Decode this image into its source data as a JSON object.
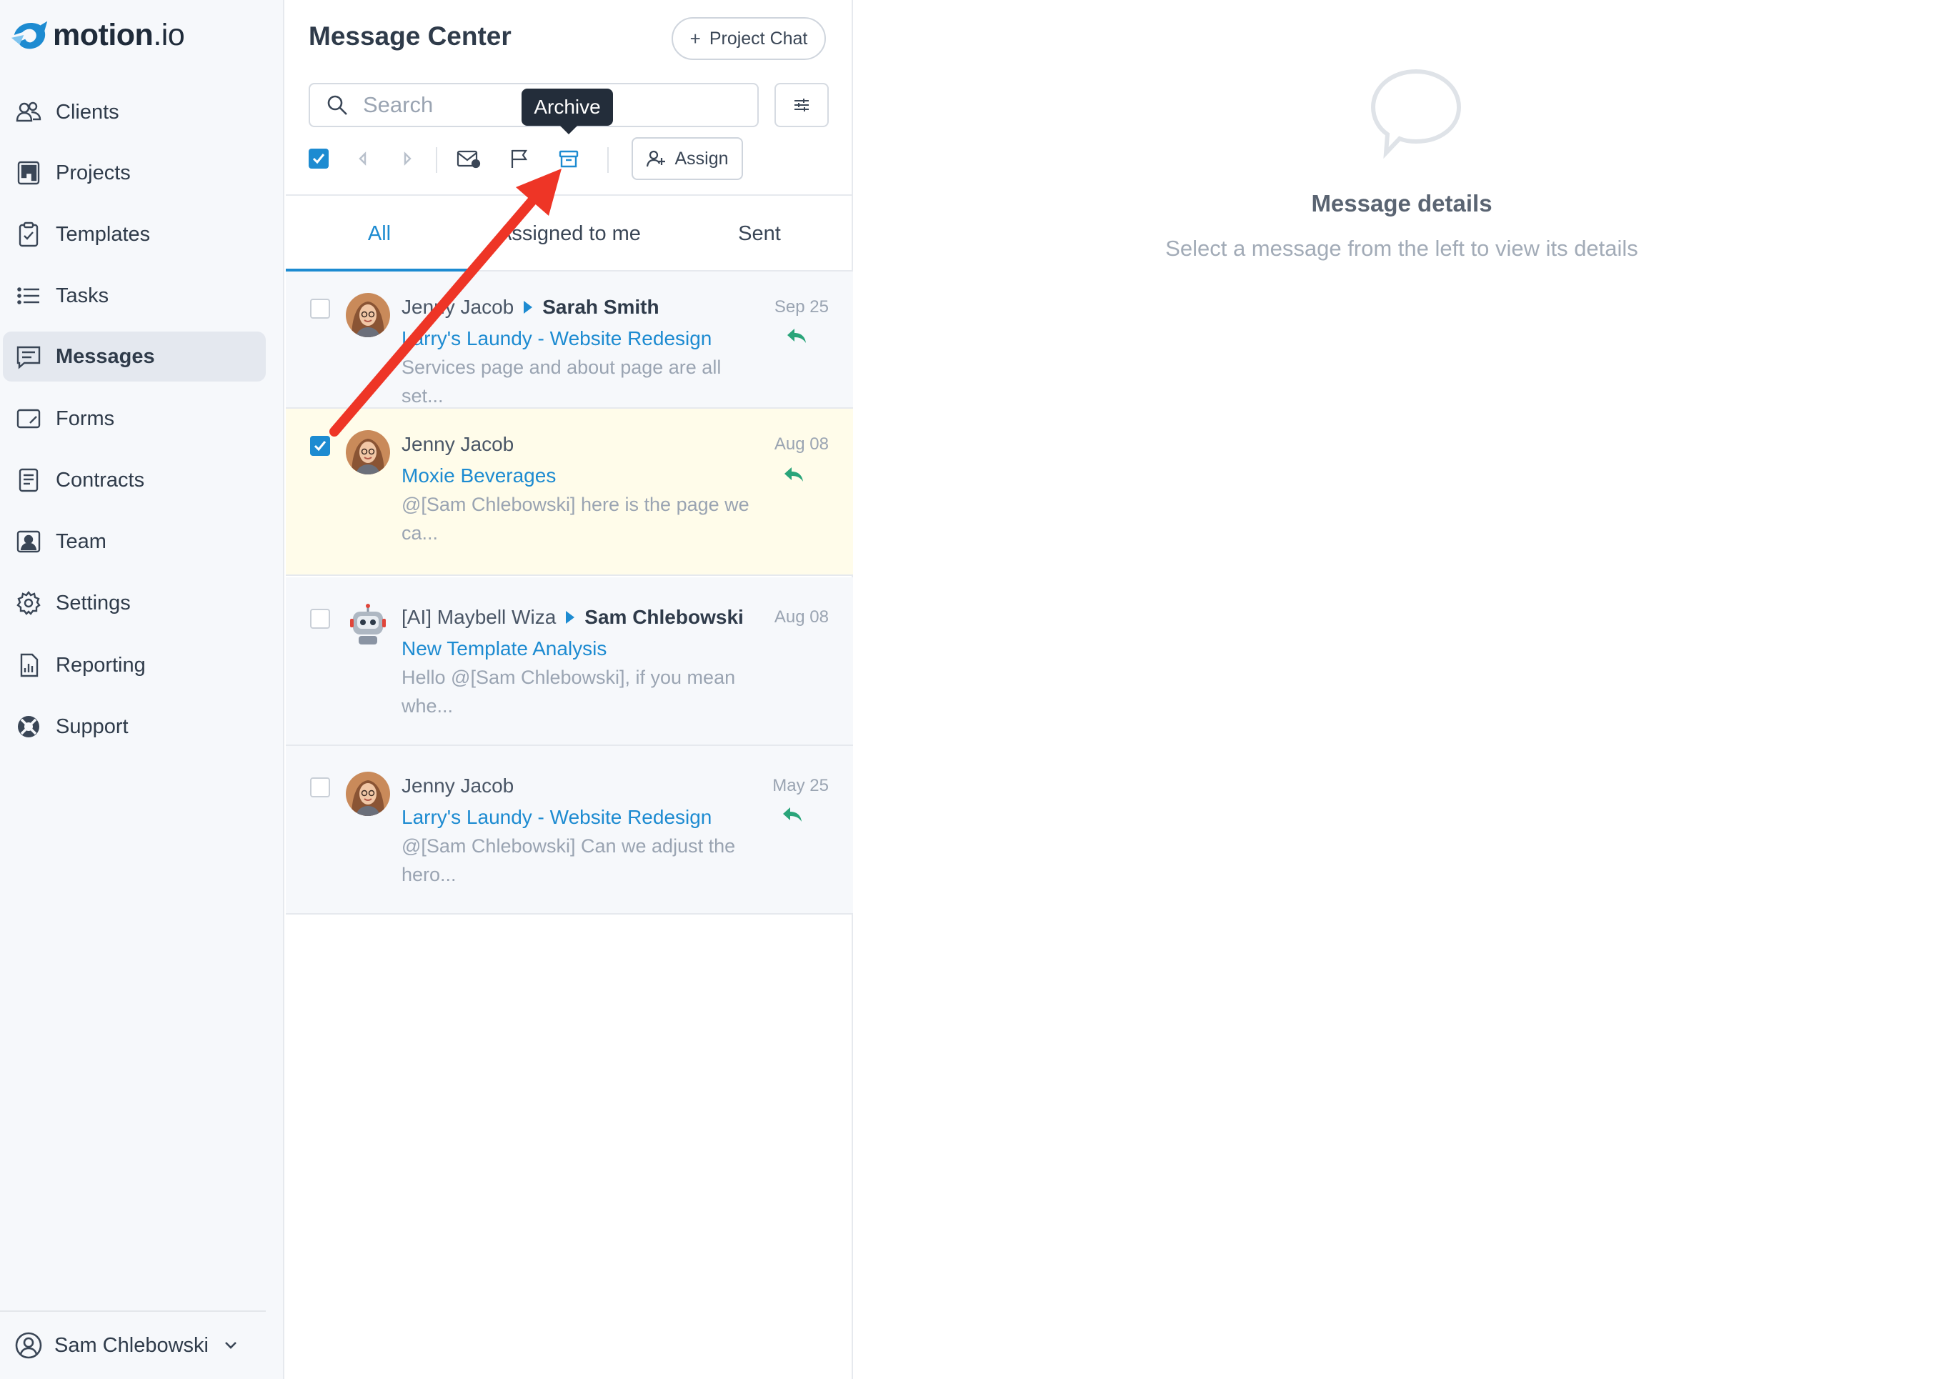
{
  "brand": {
    "name": "motion",
    "suffix": ".io",
    "accent": "#1d8bd1"
  },
  "sidebar": {
    "items": [
      {
        "label": "Clients",
        "icon": "clients-icon",
        "active": false
      },
      {
        "label": "Projects",
        "icon": "projects-icon",
        "active": false
      },
      {
        "label": "Templates",
        "icon": "templates-icon",
        "active": false
      },
      {
        "label": "Tasks",
        "icon": "tasks-icon",
        "active": false
      },
      {
        "label": "Messages",
        "icon": "messages-icon",
        "active": true
      },
      {
        "label": "Forms",
        "icon": "forms-icon",
        "active": false
      },
      {
        "label": "Contracts",
        "icon": "contracts-icon",
        "active": false
      },
      {
        "label": "Team",
        "icon": "team-icon",
        "active": false
      },
      {
        "label": "Settings",
        "icon": "gear-icon",
        "active": false
      },
      {
        "label": "Reporting",
        "icon": "reporting-icon",
        "active": false
      },
      {
        "label": "Support",
        "icon": "lifebuoy-icon",
        "active": false
      }
    ],
    "user": {
      "name": "Sam Chlebowski"
    }
  },
  "message_center": {
    "title": "Message Center",
    "project_chat_label": "Project Chat",
    "search_placeholder": "Search",
    "assign_label": "Assign",
    "tooltip": "Archive",
    "tabs": [
      {
        "label": "All",
        "active": true
      },
      {
        "label": "Assigned to me",
        "active": false
      },
      {
        "label": "Sent",
        "active": false
      }
    ],
    "messages": [
      {
        "from": "Jenny Jacob",
        "to": "Sarah Smith",
        "subject": "Larry's Laundy - Website Redesign",
        "preview": "Services page and about page are all set...",
        "date": "Sep 25",
        "checked": false,
        "replied": true,
        "avatar": "jenny-avatar"
      },
      {
        "from": "Jenny Jacob",
        "to": "",
        "subject": "Moxie Beverages",
        "preview": "@[Sam Chlebowski] here is the page we ca...",
        "date": "Aug 08",
        "checked": true,
        "replied": true,
        "avatar": "jenny-avatar"
      },
      {
        "from": "[AI] Maybell Wiza",
        "to": "Sam Chlebowski",
        "subject": "New Template Analysis",
        "preview": "Hello @[Sam Chlebowski], if you mean whe...",
        "date": "Aug 08",
        "checked": false,
        "replied": false,
        "avatar": "robot-avatar"
      },
      {
        "from": "Jenny Jacob",
        "to": "",
        "subject": "Larry's Laundy - Website Redesign",
        "preview": "@[Sam Chlebowski] Can we adjust the hero...",
        "date": "May 25",
        "checked": false,
        "replied": true,
        "avatar": "jenny-avatar"
      }
    ]
  },
  "details": {
    "title": "Message details",
    "subtitle": "Select a message from the left to view its details"
  }
}
